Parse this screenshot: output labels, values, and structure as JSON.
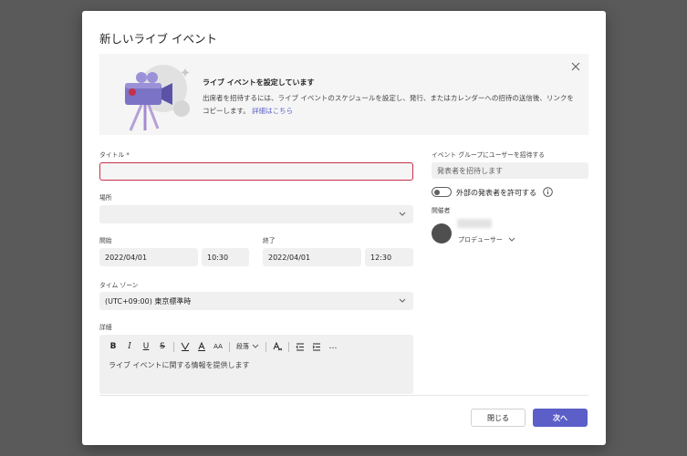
{
  "dialog": {
    "title": "新しいライブ イベント",
    "next_label": "次へ",
    "close_label": "閉じる"
  },
  "banner": {
    "heading": "ライブ イベントを設定しています",
    "description": "出席者を招待するには、ライブ イベントのスケジュールを設定し、発行、またはカレンダーへの招待の送信後、リンクをコピーします。",
    "link_text": "詳細はこちら"
  },
  "form": {
    "title_label": "タイトル *",
    "title_value": "",
    "location_label": "場所",
    "location_value": "",
    "start_label": "開始",
    "start_date": "2022/04/01",
    "start_time": "10:30",
    "end_label": "終了",
    "end_date": "2022/04/01",
    "end_time": "12:30",
    "timezone_label": "タイム ゾーン",
    "timezone_value": "(UTC+09:00) 東京標準時",
    "details_label": "詳細",
    "details_placeholder": "ライブ イベントに関する情報を提供します",
    "toolbar": {
      "bold": "B",
      "italic": "I",
      "underline": "U",
      "strike": "S",
      "font_size": "AA",
      "paragraph": "段落",
      "more": "…"
    }
  },
  "side": {
    "invite_label": "イベント グループにユーザーを招待する",
    "invite_placeholder": "発表者を招待します",
    "external_label": "外部の発表者を許可する",
    "organizer_label": "開催者",
    "role": "プロデューサー"
  },
  "colors": {
    "accent": "#5b5fc7",
    "error": "#c4314b"
  }
}
